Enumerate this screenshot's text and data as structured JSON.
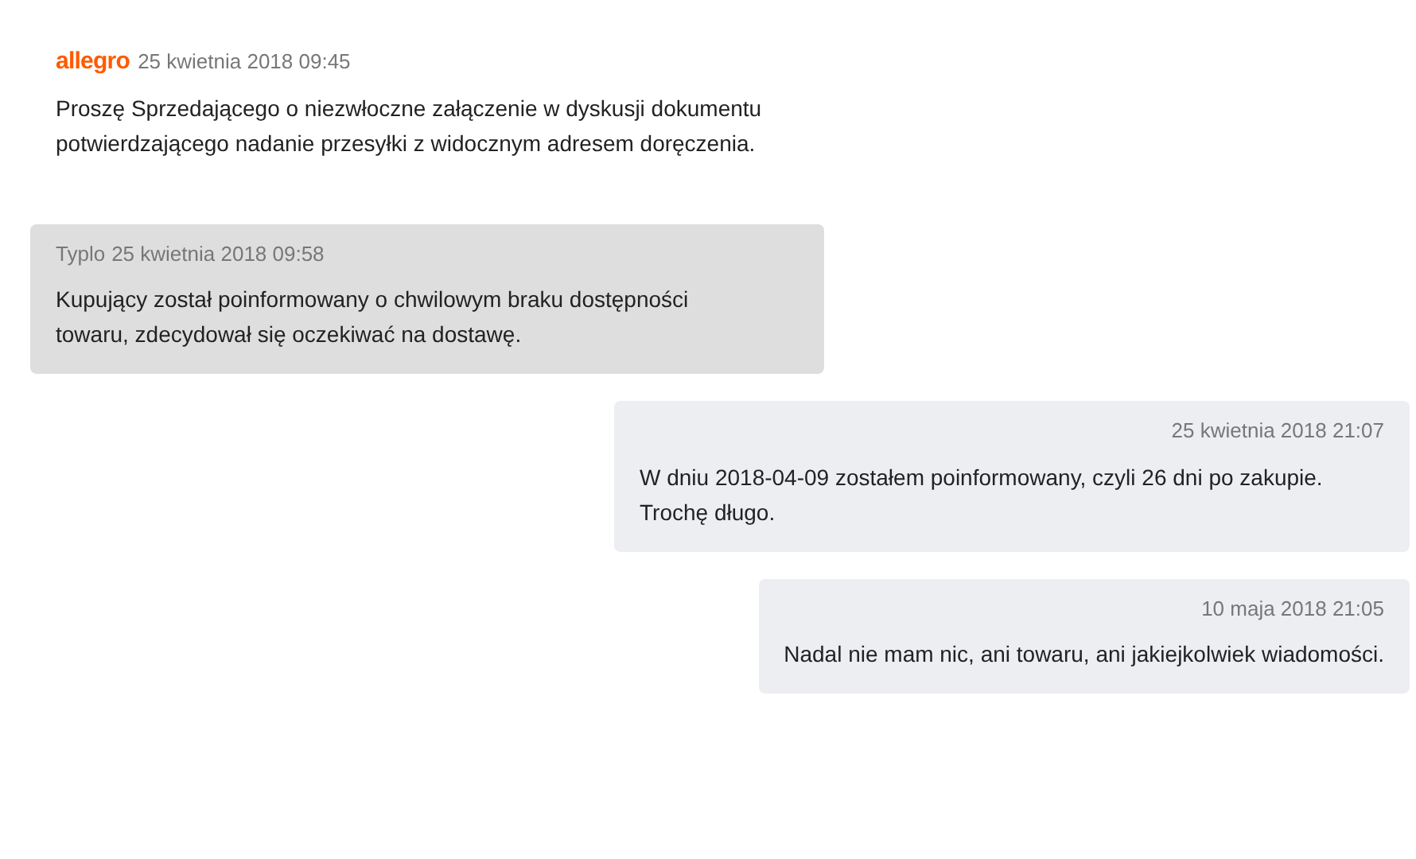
{
  "messages": [
    {
      "kind": "system",
      "sender": "allegro",
      "time": "25 kwietnia 2018 09:45",
      "text": "Proszę Sprzedającego o niezwłoczne załączenie w dyskusji dokumentu potwierdzającego nadanie przesyłki z widocznym adresem doręczenia."
    },
    {
      "kind": "seller",
      "sender": "Typlo",
      "time": "25 kwietnia 2018 09:58",
      "text": "Kupujący został poinformowany o chwilowym braku dostępności towaru, zdecydował się oczekiwać na dostawę."
    },
    {
      "kind": "buyer",
      "time": "25 kwietnia 2018 21:07",
      "text": "W dniu 2018-04-09 zostałem poinformowany, czyli 26 dni po zakupie. Trochę długo."
    },
    {
      "kind": "buyer",
      "time": "10 maja 2018 21:05",
      "text": "Nadal nie mam nic, ani towaru, ani jakiejkolwiek wiadomości."
    }
  ]
}
